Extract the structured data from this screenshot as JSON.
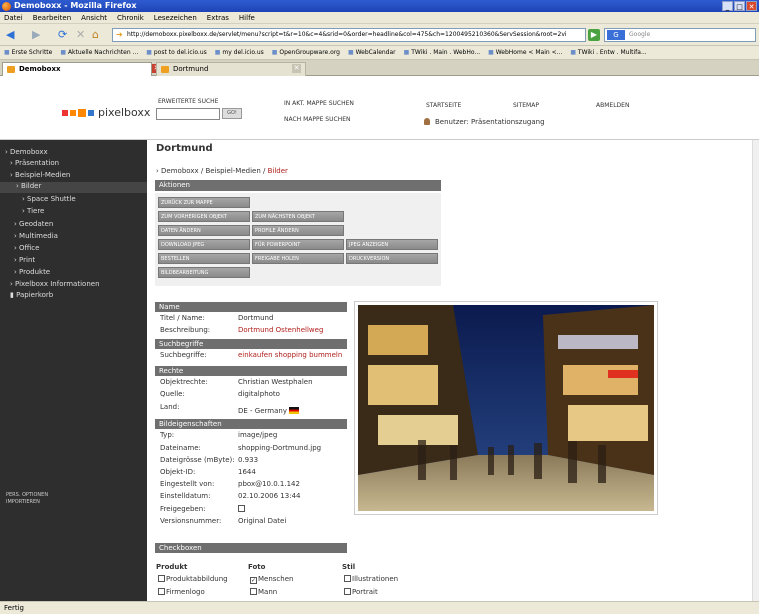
{
  "window": {
    "title": "Demoboxx - Mozilla Firefox"
  },
  "menu": [
    "Datei",
    "Bearbeiten",
    "Ansicht",
    "Chronik",
    "Lesezeichen",
    "Extras",
    "Hilfe"
  ],
  "address": {
    "url": "http://demoboxx.pixelboxx.de/servlet/menu?script=t&r=10&c=4&srid=0&order=headline&col=475&ch=1200495210360&ServSession&root=2vi",
    "search_placeholder": "Google"
  },
  "bookmarks": [
    "Erste Schritte",
    "Aktuelle Nachrichten ...",
    "post to del.icio.us",
    "my del.icio.us",
    "OpenGroupware.org",
    "WebCalendar",
    "TWiki . Main . WebHo...",
    "WebHome < Main <...",
    "TWiki . Entw . Multifa..."
  ],
  "tabs": [
    {
      "label": "Demoboxx"
    },
    {
      "label": "Dortmund"
    }
  ],
  "header": {
    "logo_text": "pixelboxx",
    "search_label": "ERWEITERTE SUCHE",
    "go_label": "GO!",
    "links": {
      "in_mappe": "IN AKT. MAPPE SUCHEN",
      "nach_mappe": "NACH MAPPE SUCHEN",
      "startseite": "STARTSEITE",
      "sitemap": "SITEMAP",
      "abmelden": "ABMELDEN"
    },
    "user": "Benutzer: Präsentationszugang"
  },
  "sidebar": {
    "items": [
      "› Demoboxx",
      "› Präsentation",
      "› Beispiel-Medien",
      "› Bilder",
      "› Space Shuttle",
      "› Tiere",
      "› Geodaten",
      "› Multimedia",
      "› Office",
      "› Print",
      "› Produkte",
      "› Pixelboxx Informationen",
      "Papierkorb"
    ],
    "footer": "PERS. OPTIONEN\nIMPORTIEREN"
  },
  "main": {
    "title": "Dortmund",
    "breadcrumb": {
      "a": "› Demoboxx / ",
      "b": "Beispiel-Medien / ",
      "current": "Bilder"
    },
    "actions_title": "Aktionen",
    "actions": [
      "ZURÜCK ZUR MAPPE",
      "ZUM VORHERIGEN OBJEKT",
      "ZUM NÄCHSTEN OBJEKT",
      "DATEN ÄNDERN",
      "PROFILE ÄNDERN",
      "DOWNLOAD JPEG",
      "FÜR POWERPOINT",
      "JPEG ANZEIGEN",
      "BESTELLEN",
      "FREIGABE HOLEN",
      "DRUCKVERSION",
      "BILDBEARBEITUNG"
    ],
    "sec_name": "Name",
    "name": {
      "titel_lbl": "Titel / Name:",
      "titel": "Dortmund",
      "beschr_lbl": "Beschreibung:",
      "beschr": "Dortmund Ostenhellweg"
    },
    "sec_such": "Suchbegriffe",
    "such": {
      "lbl": "Suchbegriffe:",
      "val": "einkaufen shopping bummeln"
    },
    "sec_rechte": "Rechte",
    "rechte": {
      "obj_lbl": "Objektrechte:",
      "obj": "Christian Westphalen",
      "quelle_lbl": "Quelle:",
      "quelle": "digitalphoto",
      "land_lbl": "Land:",
      "land": "DE - Germany"
    },
    "sec_bild": "Bildeigenschaften",
    "bild": {
      "typ_lbl": "Typ:",
      "typ": "image/jpeg",
      "datei_lbl": "Dateiname:",
      "datei": "shopping-Dortmund.jpg",
      "groesse_lbl": "Dateigrösse (mByte):",
      "groesse": "0.933",
      "id_lbl": "Objekt-ID:",
      "id": "1644",
      "von_lbl": "Eingestellt von:",
      "von": "pbox@10.0.1.142",
      "datum_lbl": "Einstelldatum:",
      "datum": "02.10.2006 13:44",
      "frei_lbl": "Freigegeben:",
      "version_lbl": "Versionsnummer:",
      "version": "Original Datei"
    },
    "sec_check": "Checkboxen",
    "checkboxes": {
      "produkt": "Produkt",
      "foto": "Foto",
      "stil": "Stil",
      "p1": "Produktabbildung",
      "p2": "Firmenlogo",
      "f1": "Menschen",
      "f2": "Mann",
      "s1": "Illustrationen",
      "s2": "Portrait"
    }
  },
  "status": "Fertig",
  "colors": {
    "accent_red": "#b0201c",
    "sidebar_bg": "#2e2e2e",
    "section_bg": "#6f6f6f"
  }
}
